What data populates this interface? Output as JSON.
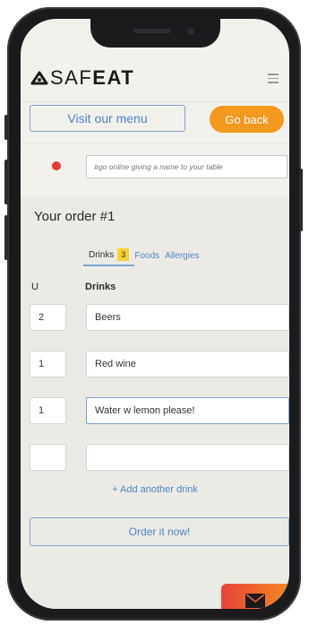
{
  "header": {
    "brand_light": "SAF",
    "brand_bold": "EAT",
    "visit_menu_label": "Visit our menu",
    "go_back_label": "Go back"
  },
  "table": {
    "status_color": "#e53935",
    "name_placeholder": "#go online giving a name to your table"
  },
  "order": {
    "title": "Your order #1",
    "tabs": [
      {
        "label": "Drinks",
        "count": "3"
      },
      {
        "label": "Foods"
      },
      {
        "label": "Allergies"
      }
    ],
    "columns": {
      "units": "U",
      "drinks": "Drinks"
    },
    "rows": [
      {
        "qty": "2",
        "drink": "Beers"
      },
      {
        "qty": "1",
        "drink": "Red wine"
      },
      {
        "qty": "1",
        "drink": "Water w lemon please!"
      },
      {
        "qty": "",
        "drink": ""
      }
    ],
    "add_label": "+ Add another drink",
    "submit_label": "Order it now!"
  },
  "colors": {
    "accent": "#4d86c6",
    "orange": "#f39a1e",
    "badge": "#f5d335"
  },
  "icons": {
    "menu": "hamburger-icon",
    "mail": "mail-icon",
    "logo": "safeat-logo-icon"
  }
}
